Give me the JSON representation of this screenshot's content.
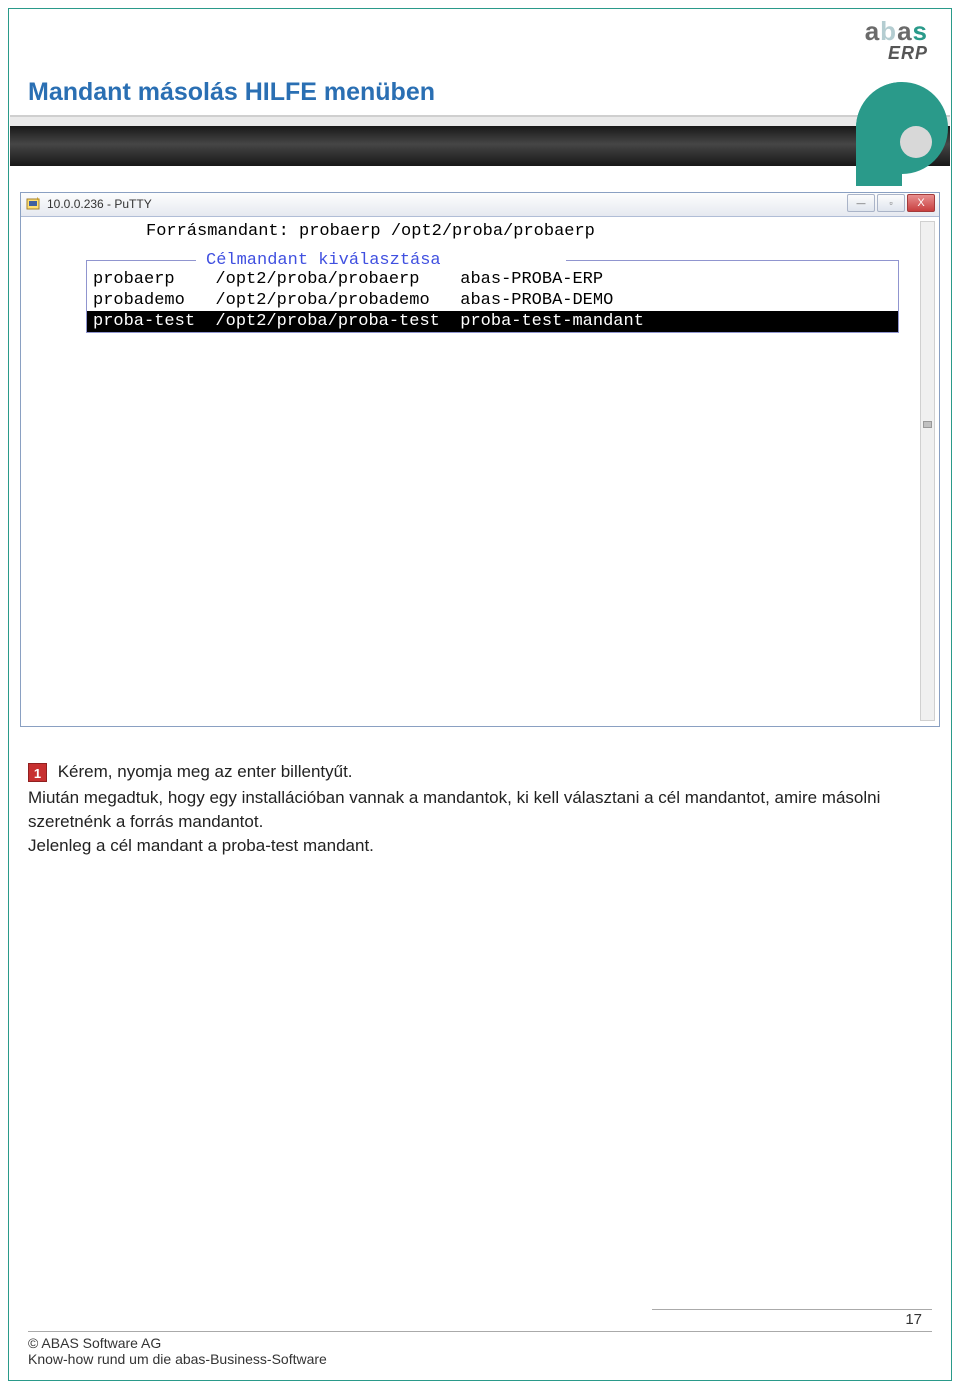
{
  "header": {
    "logo_text": "abas",
    "logo_sub": "ERP",
    "slide_title": "Mandant másolás HILFE menüben"
  },
  "putty": {
    "title": "10.0.0.236 - PuTTY",
    "btn_min": "—",
    "btn_max": "▫",
    "btn_close": "X",
    "source_line": "Forrásmandant: probaerp /opt2/proba/probaerp",
    "fieldset_title": " Célmandant kiválasztása ",
    "rows": [
      {
        "name": "probaerp",
        "path": "/opt2/proba/probaerp",
        "desc": "abas-PROBA-ERP",
        "selected": false
      },
      {
        "name": "probademo",
        "path": "/opt2/proba/probademo",
        "desc": "abas-PROBA-DEMO",
        "selected": false
      },
      {
        "name": "proba-test",
        "path": "/opt2/proba/proba-test",
        "desc": "proba-test-mandant",
        "selected": true
      }
    ]
  },
  "body": {
    "marker": "1",
    "line1": " Kérem, nyomja meg az enter billentyűt.",
    "para": "Miután megadtuk, hogy egy installációban vannak a mandantok, ki kell választani a cél mandantot, amire másolni szeretnénk a forrás mandantot.\nJelenleg a cél mandant a proba-test mandant."
  },
  "footer": {
    "copyright": "© ABAS Software AG",
    "tagline": "Know-how rund um die abas-Business-Software",
    "page_number": "17"
  }
}
